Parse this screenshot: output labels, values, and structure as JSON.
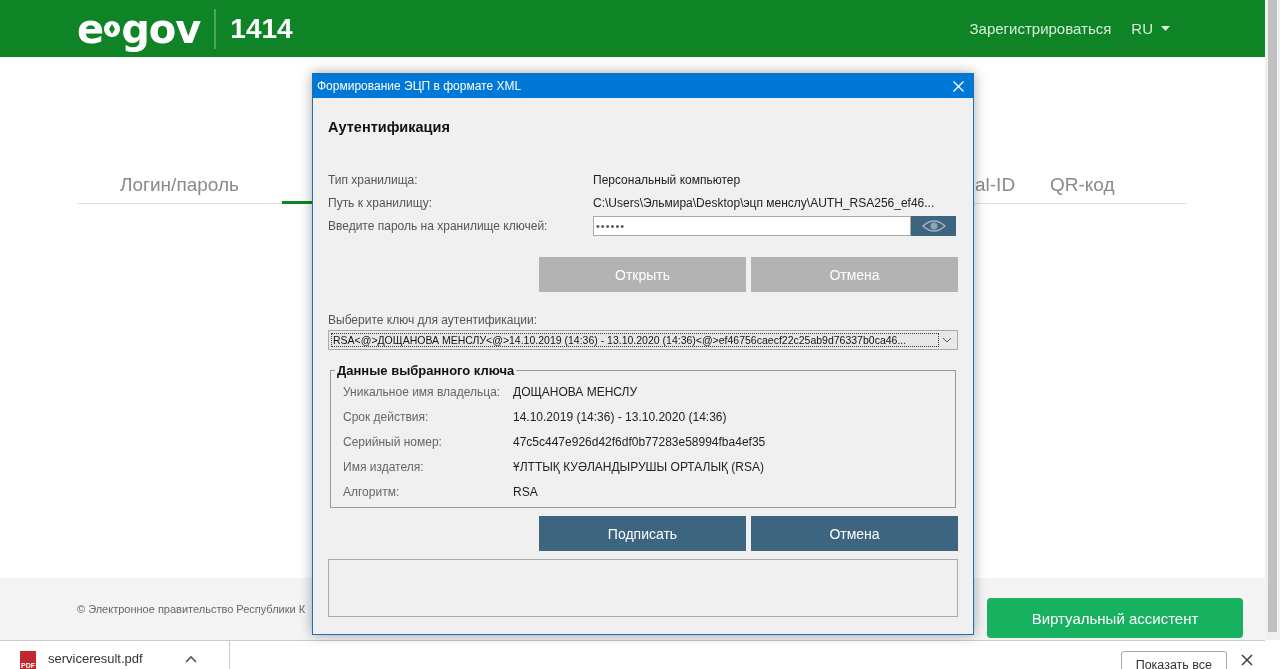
{
  "header": {
    "logo_text": "e",
    "logo_word": "gov",
    "hotline": "1414",
    "register_link": "Зарегистрироваться",
    "language": "RU"
  },
  "tabs": [
    {
      "label": "Логин/пароль",
      "selected": false
    },
    {
      "selected": true
    },
    {
      "label": "al-ID",
      "selected": false
    },
    {
      "label": "QR-код",
      "selected": false
    }
  ],
  "footer": {
    "copyright": "© Электронное правительство Республики К",
    "assistant_button": "Виртуальный ассистент"
  },
  "dialog": {
    "title": "Формирование ЭЦП в формате XML",
    "heading": "Аутентификация",
    "store_rows": [
      {
        "label": "Тип хранилища:",
        "value": "Персональный компьютер"
      },
      {
        "label": "Путь к хранилищу:",
        "value": "C:\\Users\\Эльмира\\Desktop\\эцп менслу\\AUTH_RSA256_ef46..."
      }
    ],
    "password_label": "Введите пароль на хранилище ключей:",
    "password_value": "••••••",
    "open_buttons": [
      {
        "label": "Открыть",
        "disabled": true
      },
      {
        "label": "Отмена",
        "disabled": true
      }
    ],
    "key_label": "Выберите ключ для аутентификации:",
    "key_value": "RSA<@>ДОЩАНОВА МЕНСЛУ<@>14.10.2019 (14:36) - 13.10.2020 (14:36)<@>ef46756caecf22c25ab9d76337b0ca46...",
    "key_group": {
      "legend": "Данные выбранного ключа",
      "rows": [
        {
          "label": "Уникальное имя владельца:",
          "value": "ДОЩАНОВА МЕНСЛУ"
        },
        {
          "label": "Срок действия:",
          "value": "14.10.2019 (14:36) - 13.10.2020 (14:36)"
        },
        {
          "label": "Серийный номер:",
          "value": "47c5c447e926d42f6df0b77283e58994fba4ef35"
        },
        {
          "label": "Имя издателя:",
          "value": "ҰЛТТЫҚ КУӘЛАНДЫРУШЫ ОРТАЛЫҚ (RSA)"
        },
        {
          "label": "Алгоритм:",
          "value": "RSA"
        }
      ]
    },
    "sign_buttons": [
      {
        "label": "Подписать",
        "disabled": false
      },
      {
        "label": "Отмена",
        "disabled": false
      }
    ]
  },
  "downloads": {
    "file_name": "serviceresult.pdf",
    "file_type": "PDF",
    "show_all": "Показать все"
  }
}
